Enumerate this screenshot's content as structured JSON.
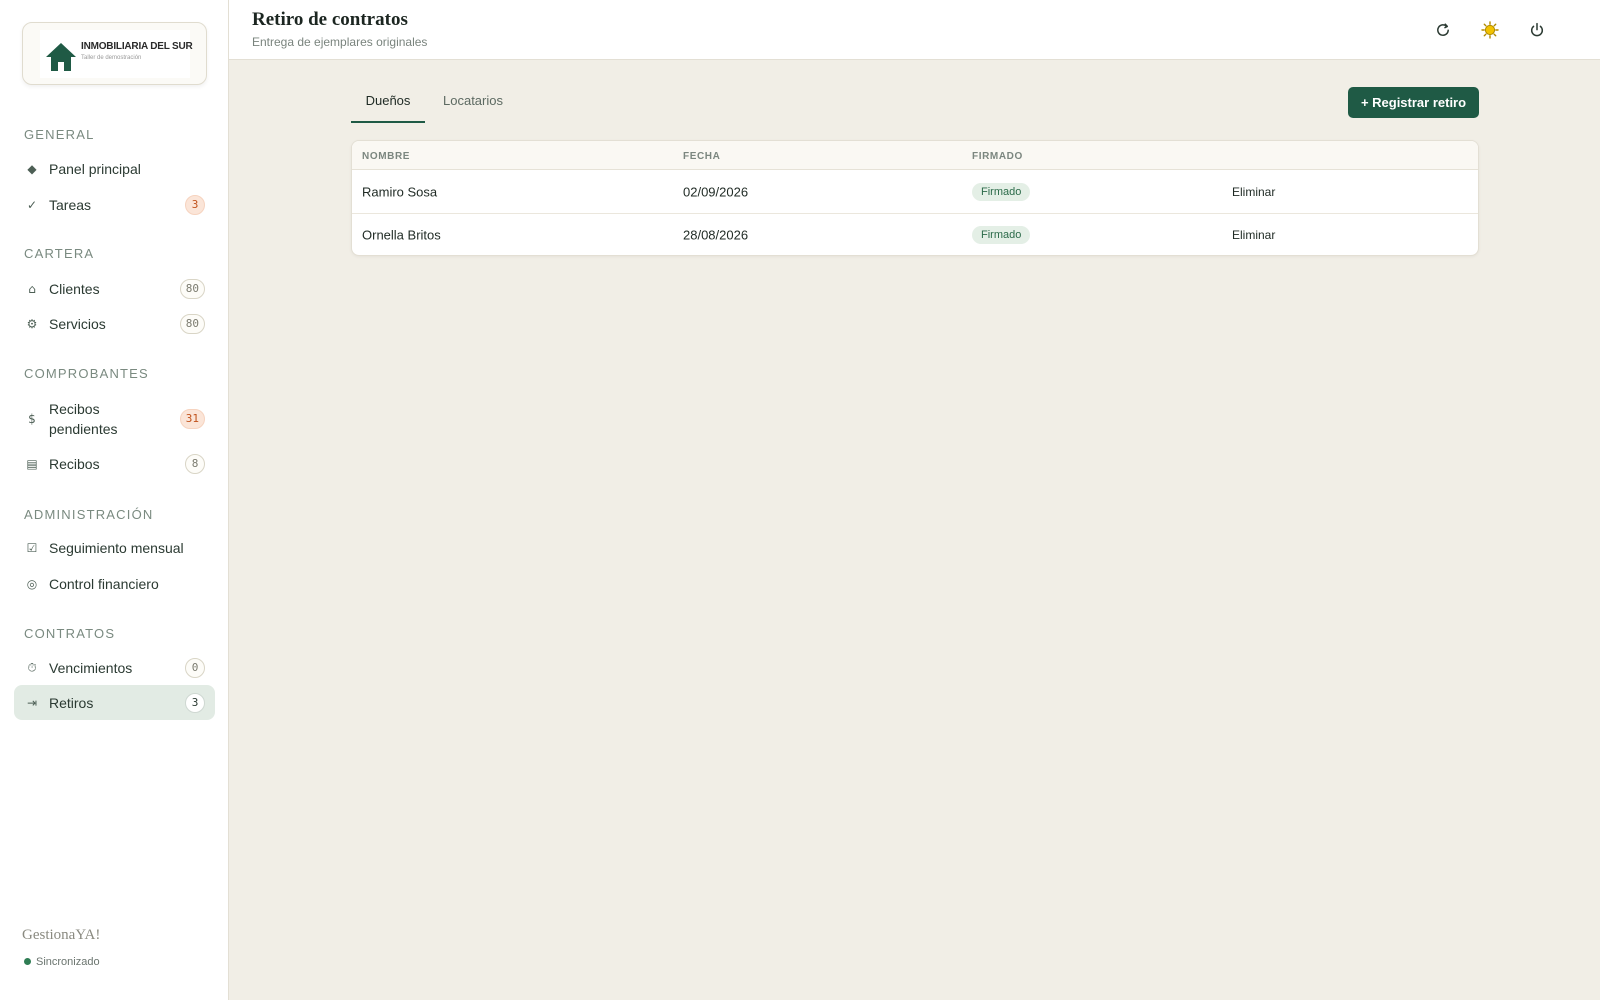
{
  "logo": {
    "title": "INMOBILIARIA DEL SUR",
    "subtitle": "Taller de demostración"
  },
  "sidebar": {
    "sections": [
      {
        "title": "GENERAL"
      },
      {
        "title": "CARTERA"
      },
      {
        "title": "COMPROBANTES"
      },
      {
        "title": "ADMINISTRACIÓN"
      },
      {
        "title": "CONTRATOS"
      }
    ],
    "items": {
      "panel": {
        "label": "Panel principal",
        "icon": "◆"
      },
      "tareas": {
        "label": "Tareas",
        "icon": "✓",
        "badge": "3"
      },
      "clientes": {
        "label": "Clientes",
        "icon": "⌂",
        "badge": "80"
      },
      "servicios": {
        "label": "Servicios",
        "icon": "⚙",
        "badge": "80"
      },
      "recibos_pendientes": {
        "label": "Recibos pendientes",
        "icon": "$",
        "badge": "31"
      },
      "recibos": {
        "label": "Recibos",
        "icon": "▤",
        "badge": "8"
      },
      "seguimiento": {
        "label": "Seguimiento mensual",
        "icon": "☑"
      },
      "control": {
        "label": "Control financiero",
        "icon": "◎"
      },
      "vencimientos": {
        "label": "Vencimientos",
        "icon": "⏱",
        "badge": "0"
      },
      "retiros": {
        "label": "Retiros",
        "icon": "⇥",
        "badge": "3"
      }
    },
    "brand": "GestionaYA!",
    "sync_status": "Sincronizado"
  },
  "header": {
    "title": "Retiro de contratos",
    "subtitle": "Entrega de ejemplares originales"
  },
  "tabs": [
    {
      "label": "Dueños"
    },
    {
      "label": "Locatarios"
    }
  ],
  "actions": {
    "register": "+ Registrar retiro"
  },
  "table": {
    "columns": [
      "NOMBRE",
      "FECHA",
      "FIRMADO"
    ],
    "rows": [
      {
        "nombre": "Ramiro Sosa",
        "fecha": "02/09/2026",
        "firmado": "Firmado",
        "action": "Eliminar"
      },
      {
        "nombre": "Ornella Britos",
        "fecha": "28/08/2026",
        "firmado": "Firmado",
        "action": "Eliminar"
      }
    ]
  },
  "colors": {
    "accent": "#1f5a45",
    "background": "#f1eee6",
    "active_nav": "#e2ebe4",
    "badge_orange": "#c1521c",
    "theme_icon": "#f2c200"
  }
}
